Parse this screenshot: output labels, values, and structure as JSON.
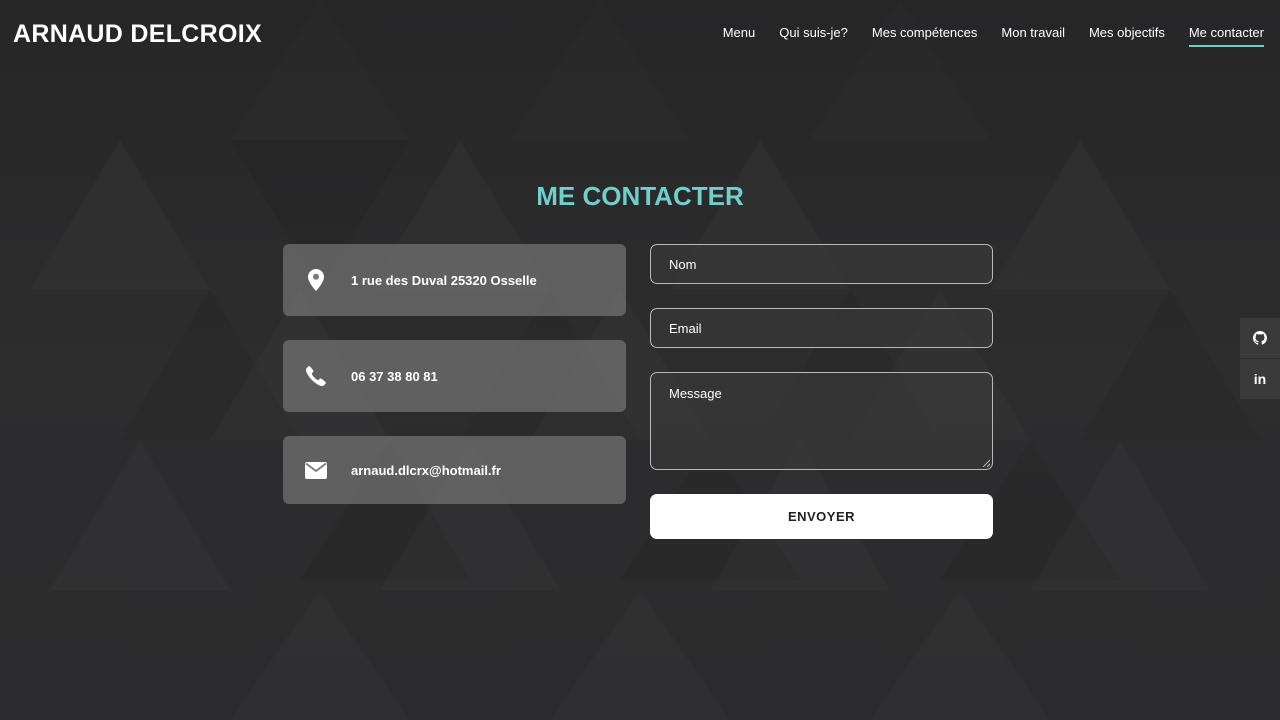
{
  "header": {
    "brand": "ARNAUD DELCROIX",
    "nav": [
      {
        "label": "Menu",
        "active": false
      },
      {
        "label": "Qui suis-je?",
        "active": false
      },
      {
        "label": "Mes compétences",
        "active": false
      },
      {
        "label": "Mon travail",
        "active": false
      },
      {
        "label": "Mes objectifs",
        "active": false
      },
      {
        "label": "Me contacter",
        "active": true
      }
    ]
  },
  "contact": {
    "title": "ME CONTACTER",
    "info": [
      {
        "icon": "map-pin-icon",
        "text": "1 rue des Duval 25320 Osselle"
      },
      {
        "icon": "phone-icon",
        "text": "06 37 38 80 81"
      },
      {
        "icon": "envelope-icon",
        "text": "arnaud.dlcrx@hotmail.fr"
      }
    ],
    "form": {
      "name_placeholder": "Nom",
      "email_placeholder": "Email",
      "message_placeholder": "Message",
      "submit_label": "ENVOYER"
    }
  },
  "social": [
    {
      "icon": "github-icon"
    },
    {
      "icon": "linkedin-icon",
      "glyph": "in"
    }
  ],
  "colors": {
    "accent": "#6ecfcb",
    "background": "#2a2a2b",
    "card": "#7a7a7a",
    "button": "#ffffff"
  }
}
